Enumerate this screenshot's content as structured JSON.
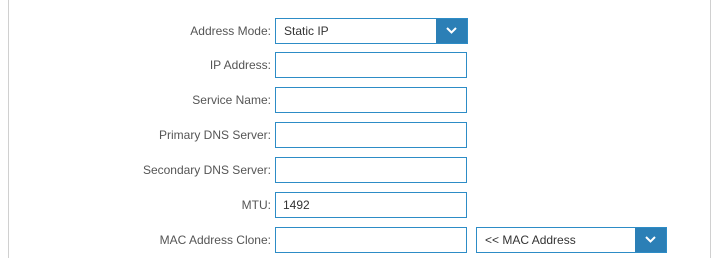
{
  "form": {
    "address_mode": {
      "label": "Address Mode:",
      "value": "Static IP"
    },
    "ip_address": {
      "label": "IP Address:",
      "value": ""
    },
    "service_name": {
      "label": "Service Name:",
      "value": ""
    },
    "primary_dns": {
      "label": "Primary DNS Server:",
      "value": ""
    },
    "secondary_dns": {
      "label": "Secondary DNS Server:",
      "value": ""
    },
    "mtu": {
      "label": "MTU:",
      "value": "1492"
    },
    "mac_clone": {
      "label": "MAC Address Clone:",
      "value": "",
      "select_value": "<< MAC Address"
    }
  },
  "colors": {
    "accent": "#2b7fb6",
    "border": "#2d8cc6",
    "label": "#555555"
  },
  "icons": {
    "dropdown": "chevron-down-icon"
  }
}
